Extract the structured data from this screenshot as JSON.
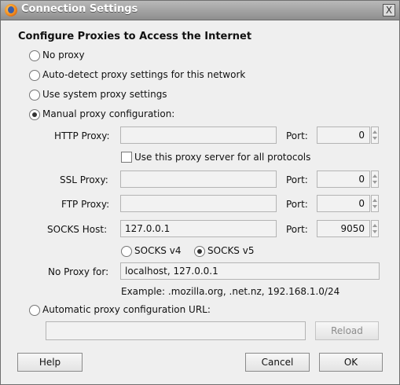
{
  "window": {
    "title": "Connection Settings",
    "close_glyph": "X"
  },
  "heading": "Configure Proxies to Access the Internet",
  "options": {
    "no_proxy": "No proxy",
    "auto_detect": "Auto-detect proxy settings for this network",
    "system": "Use system proxy settings",
    "manual": "Manual proxy configuration:",
    "selected": "manual"
  },
  "manual": {
    "http": {
      "label": "HTTP Proxy:",
      "value": "",
      "port_label": "Port:",
      "port": "0"
    },
    "use_same": {
      "label": "Use this proxy server for all protocols",
      "checked": false
    },
    "ssl": {
      "label": "SSL Proxy:",
      "value": "",
      "port_label": "Port:",
      "port": "0"
    },
    "ftp": {
      "label": "FTP Proxy:",
      "value": "",
      "port_label": "Port:",
      "port": "0"
    },
    "socks": {
      "label": "SOCKS Host:",
      "value": "127.0.0.1",
      "port_label": "Port:",
      "port": "9050"
    },
    "socks_v4": "SOCKS v4",
    "socks_v5": "SOCKS v5",
    "socks_version_selected": "v5",
    "no_proxy_for": {
      "label": "No Proxy for:",
      "value": "localhost, 127.0.0.1"
    },
    "example": "Example: .mozilla.org, .net.nz, 192.168.1.0/24"
  },
  "auto_config": {
    "label": "Automatic proxy configuration URL:",
    "value": "",
    "reload": "Reload"
  },
  "buttons": {
    "help": "Help",
    "cancel": "Cancel",
    "ok": "OK"
  }
}
